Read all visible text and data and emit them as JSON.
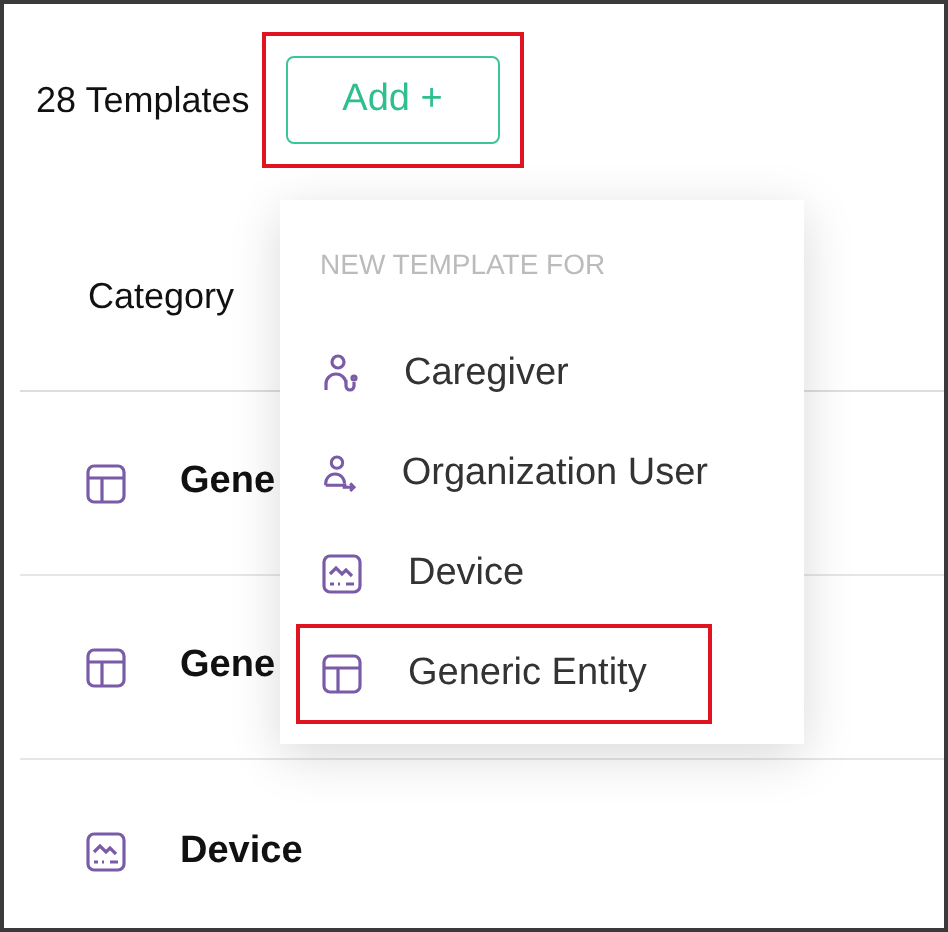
{
  "header": {
    "count_label": "28 Templates",
    "add_button": {
      "label": "Add +",
      "highlighted": true
    }
  },
  "table": {
    "columns": [
      "Category"
    ],
    "rows": [
      {
        "kind": "layout",
        "name": "Gene"
      },
      {
        "kind": "layout",
        "name": "Gene"
      },
      {
        "kind": "device",
        "name": "Device"
      }
    ]
  },
  "menu": {
    "heading": "NEW TEMPLATE FOR",
    "items": [
      {
        "kind": "caregiver",
        "label": "Caregiver",
        "highlighted": false
      },
      {
        "kind": "org-user",
        "label": "Organization User",
        "highlighted": false
      },
      {
        "kind": "device",
        "label": "Device",
        "highlighted": false
      },
      {
        "kind": "layout",
        "label": "Generic Entity",
        "highlighted": true
      }
    ]
  }
}
